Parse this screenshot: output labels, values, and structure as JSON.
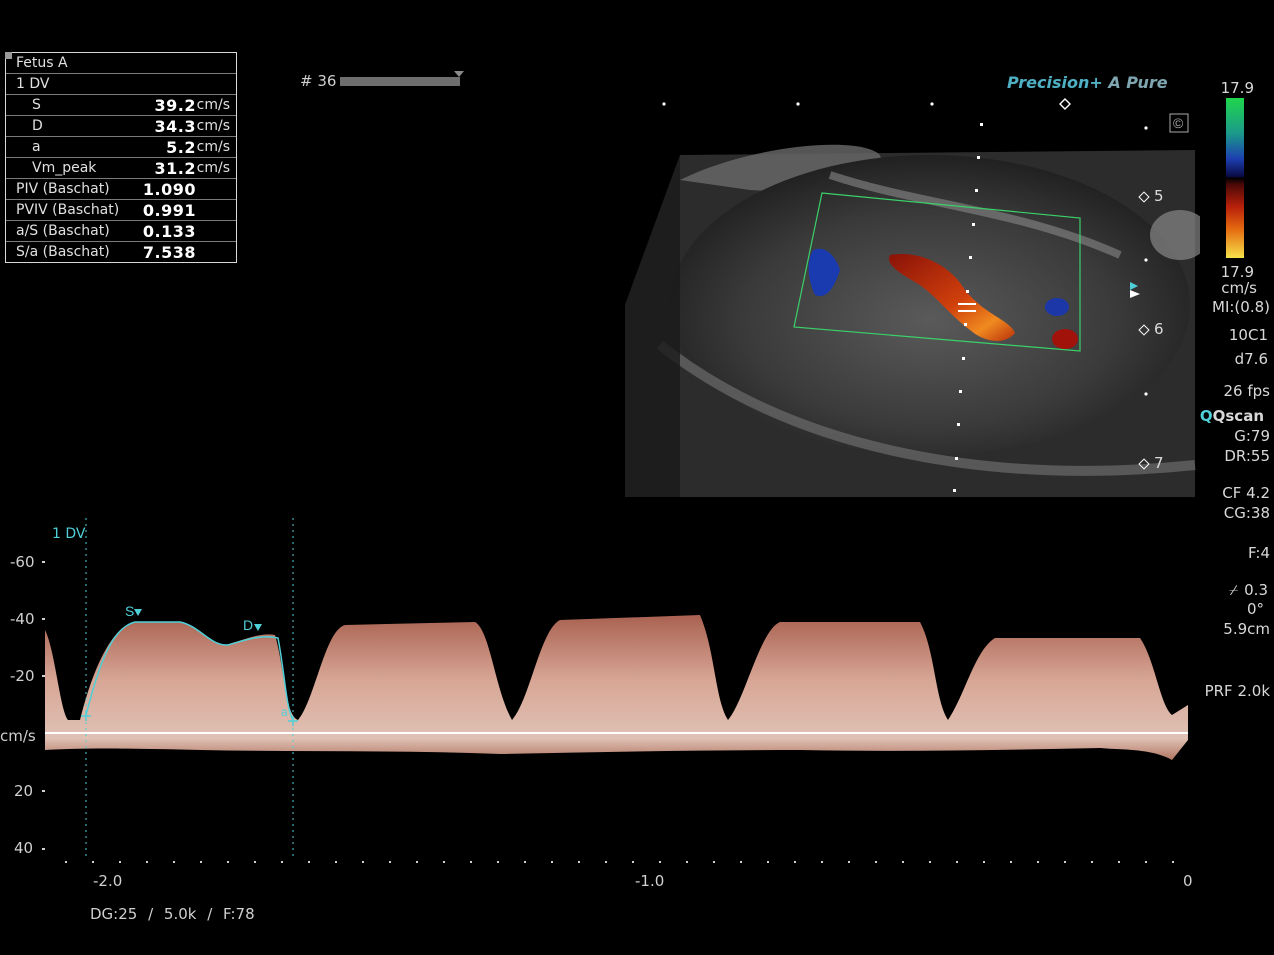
{
  "measurements": {
    "title": "Fetus A",
    "vessel": "1 DV",
    "rows": [
      {
        "label": "S",
        "value": "39.2",
        "unit": "cm/s",
        "indent": true
      },
      {
        "label": "D",
        "value": "34.3",
        "unit": "cm/s",
        "indent": true
      },
      {
        "label": "a",
        "value": "5.2",
        "unit": "cm/s",
        "indent": true
      },
      {
        "label": "Vm_peak",
        "value": "31.2",
        "unit": "cm/s",
        "indent": true
      },
      {
        "label": "PIV (Baschat)",
        "value": "1.090",
        "unit": "",
        "indent": false
      },
      {
        "label": "PVIV (Baschat)",
        "value": "0.991",
        "unit": "",
        "indent": false
      },
      {
        "label": "a/S (Baschat)",
        "value": "0.133",
        "unit": "",
        "indent": false
      },
      {
        "label": "S/a (Baschat)",
        "value": "7.538",
        "unit": "",
        "indent": false
      }
    ]
  },
  "header": {
    "frame_number": "# 36",
    "brand_precision": "Precision+",
    "brand_apure": "A Pure"
  },
  "depth_markers": [
    "5",
    "6",
    "7"
  ],
  "color_scale": {
    "top": "17.9",
    "bottom": "17.9",
    "unit": "cm/s"
  },
  "params": {
    "mi": "MI:(0.8)",
    "probe": "10C1",
    "depth": "d7.6",
    "fps": "26 fps",
    "qscan": "Qscan",
    "gain": "G:79",
    "dr": "DR:55",
    "cf": "CF 4.2",
    "cg": "CG:38",
    "f": "F:4",
    "angle_val": "0.3",
    "angle": "0°",
    "gate": "5.9cm",
    "prf": "PRF 2.0k"
  },
  "spectral": {
    "vessel_label": "1 DV",
    "y_unit": "cm/s",
    "y_ticks": [
      "-60",
      "-40",
      "-20",
      "20",
      "40"
    ],
    "x_ticks": [
      "-2.0",
      "-1.0",
      "0"
    ],
    "trace_labels": {
      "s": "S",
      "d": "D",
      "a": "a"
    },
    "footer": "DG:25   / 5.0k   / F:78"
  },
  "colors": {
    "trace": "#4fd0d8",
    "doppler": "#e8a08a",
    "background": "#000000"
  }
}
